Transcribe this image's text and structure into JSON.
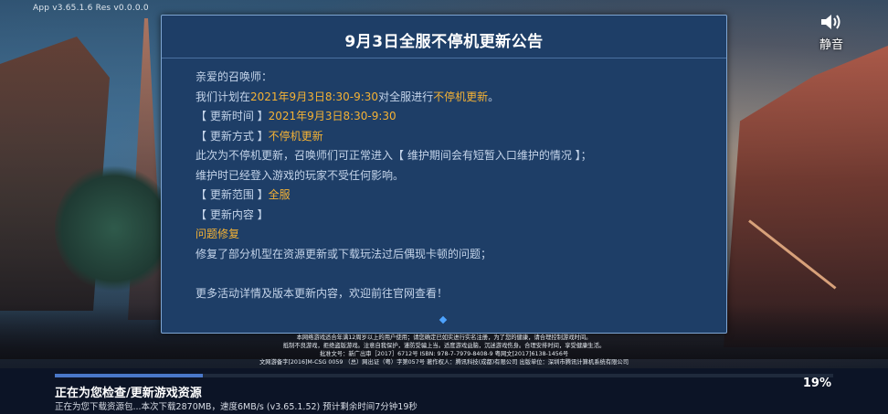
{
  "version": "App v3.65.1.6   Res v0.0.0.0",
  "mute": {
    "label": "静音",
    "icon": "speaker-icon"
  },
  "notice": {
    "title": "9月3日全服不停机更新公告",
    "lines": [
      [
        {
          "t": "亲爱的召唤师："
        }
      ],
      [
        {
          "t": "我们计划在"
        },
        {
          "t": "2021年9月3日8:30-9:30",
          "hl": true
        },
        {
          "t": "对全服进行"
        },
        {
          "t": "不停机更新",
          "hl": true
        },
        {
          "t": "。"
        }
      ],
      [
        {
          "t": "【 更新时间 】"
        },
        {
          "t": "2021年9月3日8:30-9:30",
          "hl": true
        }
      ],
      [
        {
          "t": "【 更新方式 】"
        },
        {
          "t": "不停机更新",
          "hl": true
        }
      ],
      [
        {
          "t": "此次为不停机更新，召唤师们可正常进入【 维护期间会有短暂入口维护的情况 】；"
        }
      ],
      [
        {
          "t": "维护时已经登入游戏的玩家不受任何影响。"
        }
      ],
      [
        {
          "t": "【 更新范围 】"
        },
        {
          "t": "全服",
          "hl": true
        }
      ],
      [
        {
          "t": "【 更新内容 】"
        }
      ],
      [
        {
          "t": "问题修复",
          "hl": true
        }
      ],
      [
        {
          "t": "修复了部分机型在资源更新或下载玩法过后偶现卡顿的问题；"
        }
      ],
      [],
      [
        {
          "t": "更多活动详情及版本更新内容，欢迎前往官网查看！"
        }
      ]
    ]
  },
  "legal": [
    "本网络游戏适合年满12周岁以上的用户使用；请您确定已如实进行实名注册，为了您的健康，请合理控制游戏时间。",
    "抵制不良游戏，拒绝盗版游戏。注意自我保护，谨防受骗上当。适度游戏益脑，沉迷游戏伤身。合理安排时间，享受健康生活。",
    "批准文号：新广出审［2017］6712号 ISBN: 978-7-7979-8408-9 粤网文[2017]6138-1456号",
    "文网游备字[2016]M-CSG 0059 （总）网出证（粤）字第057号 著作权人：腾讯科技(成都)有限公司 出版单位：深圳市腾讯计算机系统有限公司"
  ],
  "loading": {
    "progress": 0.19,
    "percent_label": "19%",
    "status": "正在为您检查/更新游戏资源",
    "detail": "正在为您下载资源包...本次下载2870MB，速度6MB/s (v3.65.1.52)  预计剩余时间7分钟19秒"
  },
  "colors": {
    "highlight": "#f5b234",
    "dialog_bg": "#1e3e67",
    "progress_fill": "#4a78c9"
  }
}
